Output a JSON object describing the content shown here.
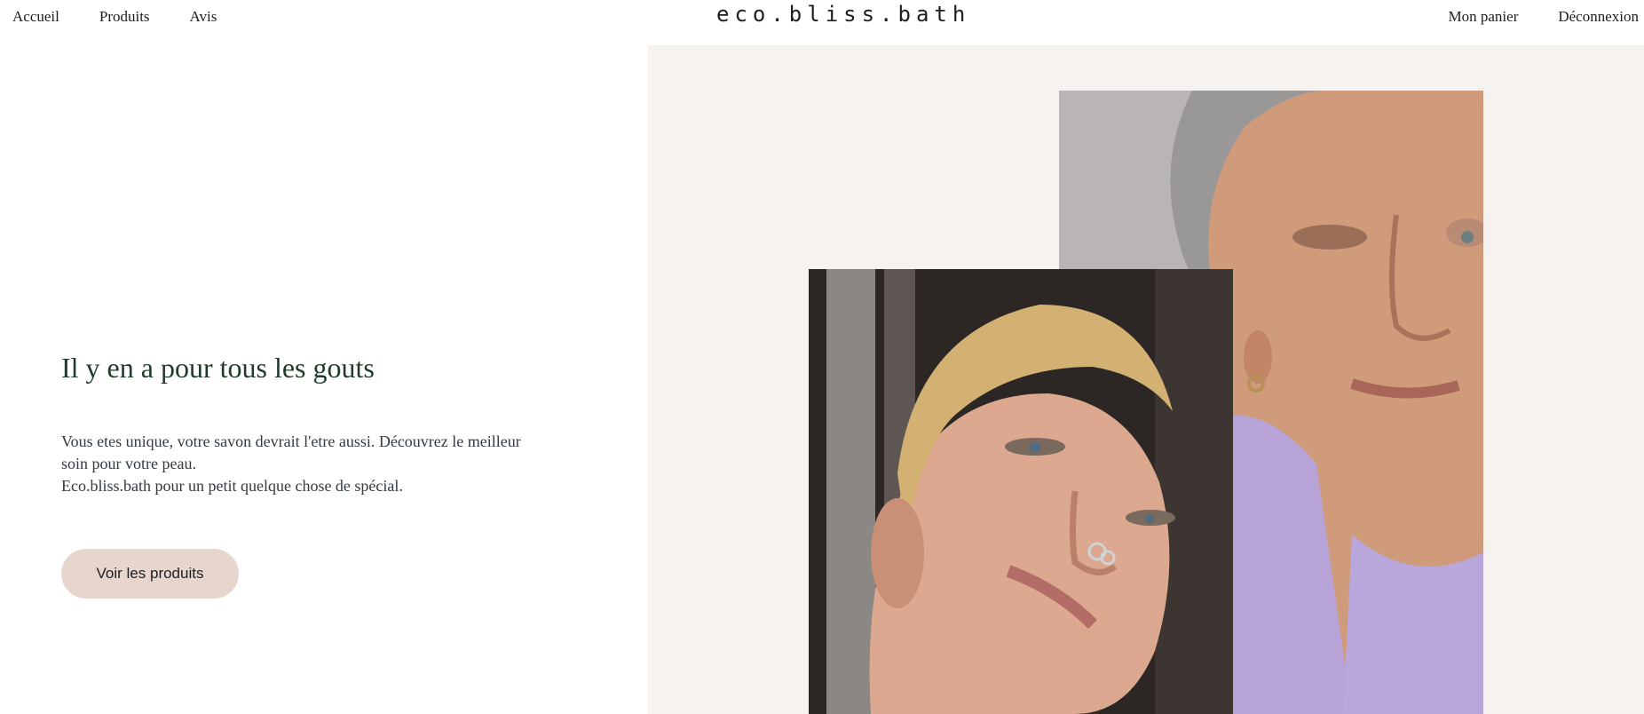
{
  "header": {
    "nav_left": [
      "Accueil",
      "Produits",
      "Avis"
    ],
    "logo": "eco.bliss.bath",
    "nav_right": [
      "Mon panier",
      "Déconnexion"
    ]
  },
  "hero": {
    "title": "Il y en a pour tous les gouts",
    "text_line1": "Vous etes unique, votre savon devrait l'etre aussi. Découvrez le meilleur",
    "text_line2": "soin pour votre peau.",
    "text_line3": "Eco.bliss.bath pour un petit quelque chose de spécial.",
    "cta_label": "Voir les produits"
  },
  "colors": {
    "title": "#1f3b2a",
    "cta_bg": "#e7d6cd",
    "panel_bg": "#f6f2ef"
  }
}
